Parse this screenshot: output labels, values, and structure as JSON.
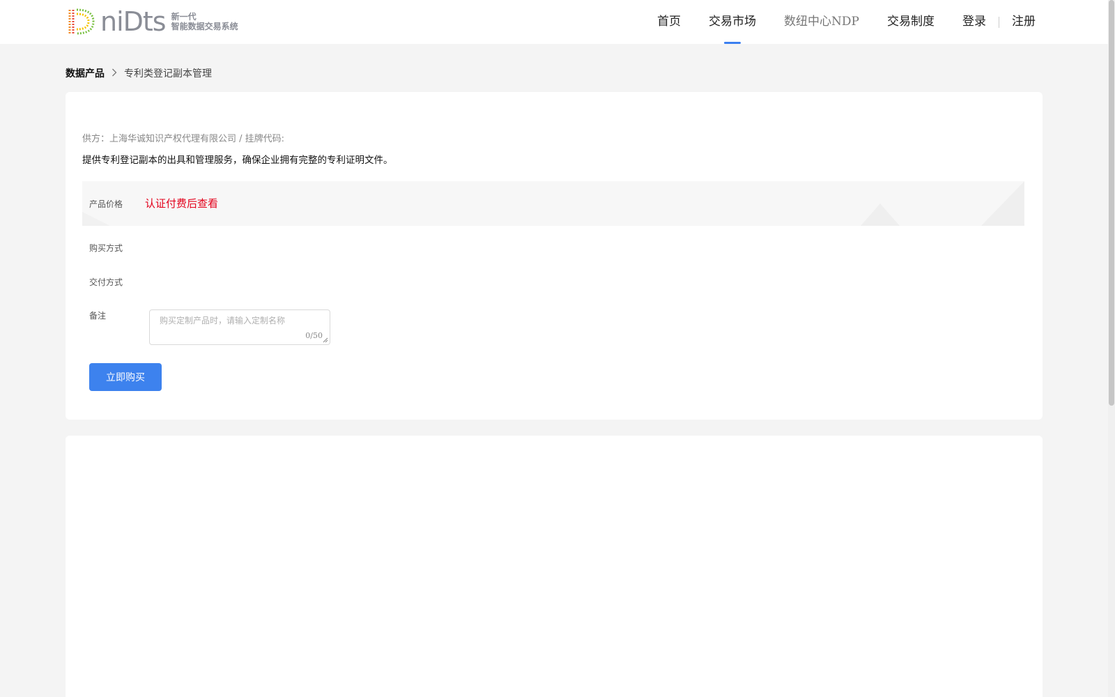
{
  "header": {
    "logo": {
      "word": "niDts",
      "tag_line1": "新一代",
      "tag_line2": "智能数据交易系统"
    },
    "nav": [
      {
        "label": "首页"
      },
      {
        "label": "交易市场"
      },
      {
        "label": "数纽中心NDP"
      },
      {
        "label": "交易制度"
      }
    ],
    "login": "登录",
    "register": "注册"
  },
  "breadcrumb": {
    "root": "数据产品",
    "current": "专利类登记副本管理"
  },
  "product": {
    "supplier": "供方：上海华诚知识产权代理有限公司 / 挂牌代码:",
    "description": "提供专利登记副本的出具和管理服务，确保企业拥有完整的专利证明文件。",
    "price_label": "产品价格",
    "price_value": "认证付费后查看",
    "purchase_method_label": "购买方式",
    "delivery_method_label": "交付方式",
    "remark_label": "备注",
    "remark_placeholder": "购买定制产品时，请输入定制名称",
    "remark_counter": "0/50",
    "buy_button": "立即购买"
  },
  "colors": {
    "accent": "#3d82ee",
    "price": "#e3001b",
    "nav_indicator": "#3b7ff0"
  }
}
